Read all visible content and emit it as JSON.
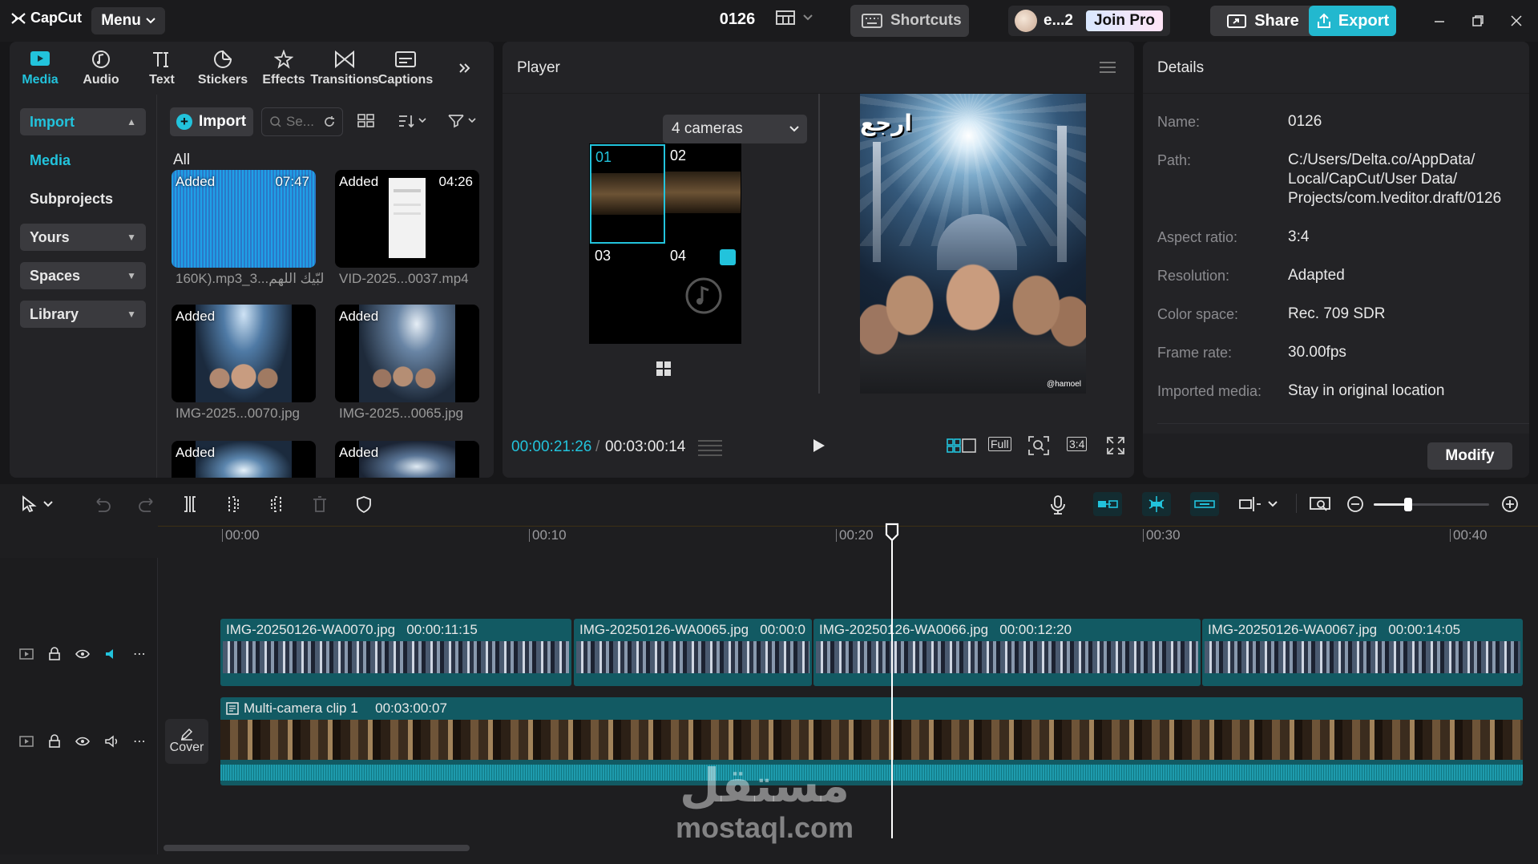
{
  "app": {
    "name": "CapCut",
    "menu_label": "Menu",
    "project_title": "0126"
  },
  "topbar": {
    "shortcuts_label": "Shortcuts",
    "username": "e...2",
    "join_pro_label": "Join Pro",
    "share_label": "Share",
    "export_label": "Export"
  },
  "tools": [
    {
      "label": "Media",
      "icon": "media-icon"
    },
    {
      "label": "Audio",
      "icon": "audio-icon"
    },
    {
      "label": "Text",
      "icon": "text-icon"
    },
    {
      "label": "Stickers",
      "icon": "stickers-icon"
    },
    {
      "label": "Effects",
      "icon": "effects-icon"
    },
    {
      "label": "Transitions",
      "icon": "transitions-icon"
    },
    {
      "label": "Captions",
      "icon": "captions-icon"
    }
  ],
  "sidebar": {
    "import": "Import",
    "media": "Media",
    "subprojects": "Subprojects",
    "yours": "Yours",
    "spaces": "Spaces",
    "library": "Library"
  },
  "media": {
    "import_button": "Import",
    "search_placeholder": "Se...",
    "filter_label": "All",
    "added_badge": "Added",
    "items": [
      {
        "name": "160K).mp3_3...لبّيك اللهم",
        "duration": "07:47"
      },
      {
        "name": "VID-2025...0037.mp4",
        "duration": "04:26"
      },
      {
        "name": "IMG-2025...0070.jpg",
        "duration": ""
      },
      {
        "name": "IMG-2025...0065.jpg",
        "duration": ""
      }
    ]
  },
  "player": {
    "title": "Player",
    "camera_select": "4 cameras",
    "cameras": [
      "01",
      "02",
      "03",
      "04"
    ],
    "time_current": "00:00:21:26",
    "time_separator": "/",
    "time_total": "00:03:00:14",
    "full_label": "Full",
    "ratio_label": "3:4",
    "overlay_arabic": "ارجع",
    "overlay_credit": "@hamoel"
  },
  "details": {
    "title": "Details",
    "rows": [
      {
        "label": "Name:",
        "value": "0126"
      },
      {
        "label": "Path:",
        "value": "C:/Users/Delta.co/AppData/ Local/CapCut/User Data/ Projects/com.lveditor.draft/0126"
      },
      {
        "label": "Aspect ratio:",
        "value": "3:4"
      },
      {
        "label": "Resolution:",
        "value": "Adapted"
      },
      {
        "label": "Color space:",
        "value": "Rec. 709 SDR"
      },
      {
        "label": "Frame rate:",
        "value": "30.00fps"
      },
      {
        "label": "Imported media:",
        "value": "Stay in original location"
      }
    ],
    "modify_button": "Modify"
  },
  "timeline": {
    "ruler": [
      "00:00",
      "00:10",
      "00:20",
      "00:30",
      "00:40"
    ],
    "zoom_level": 0.3,
    "clips": [
      {
        "name": "IMG-20250126-WA0070.jpg",
        "duration": "00:00:11:15"
      },
      {
        "name": "IMG-20250126-WA0065.jpg",
        "duration": "00:00:0"
      },
      {
        "name": "IMG-20250126-WA0066.jpg",
        "duration": "00:00:12:20"
      },
      {
        "name": "IMG-20250126-WA0067.jpg",
        "duration": "00:00:14:05"
      }
    ],
    "main_clip": {
      "name": "Multi-camera clip 1",
      "duration": "00:03:00:07"
    },
    "cover_label": "Cover"
  },
  "watermark": {
    "arabic": "مستقل",
    "latin": "mostaql.com"
  },
  "colors": {
    "accent": "#22c3dc",
    "export": "#22b8cf",
    "clip": "#125a63",
    "panel": "#232326",
    "background": "#171719"
  }
}
